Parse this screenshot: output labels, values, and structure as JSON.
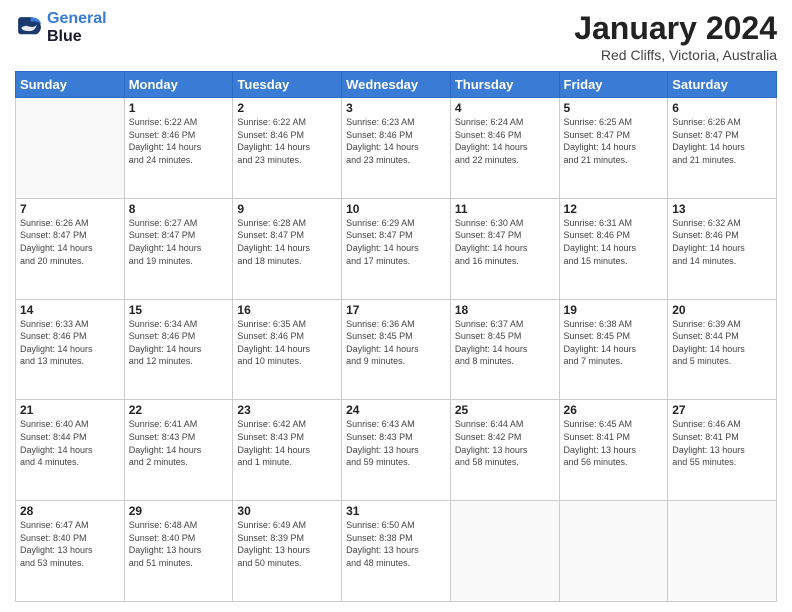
{
  "logo": {
    "line1": "General",
    "line2": "Blue"
  },
  "title": "January 2024",
  "location": "Red Cliffs, Victoria, Australia",
  "weekdays": [
    "Sunday",
    "Monday",
    "Tuesday",
    "Wednesday",
    "Thursday",
    "Friday",
    "Saturday"
  ],
  "weeks": [
    [
      {
        "day": "",
        "info": ""
      },
      {
        "day": "1",
        "info": "Sunrise: 6:22 AM\nSunset: 8:46 PM\nDaylight: 14 hours\nand 24 minutes."
      },
      {
        "day": "2",
        "info": "Sunrise: 6:22 AM\nSunset: 8:46 PM\nDaylight: 14 hours\nand 23 minutes."
      },
      {
        "day": "3",
        "info": "Sunrise: 6:23 AM\nSunset: 8:46 PM\nDaylight: 14 hours\nand 23 minutes."
      },
      {
        "day": "4",
        "info": "Sunrise: 6:24 AM\nSunset: 8:46 PM\nDaylight: 14 hours\nand 22 minutes."
      },
      {
        "day": "5",
        "info": "Sunrise: 6:25 AM\nSunset: 8:47 PM\nDaylight: 14 hours\nand 21 minutes."
      },
      {
        "day": "6",
        "info": "Sunrise: 6:26 AM\nSunset: 8:47 PM\nDaylight: 14 hours\nand 21 minutes."
      }
    ],
    [
      {
        "day": "7",
        "info": "Sunrise: 6:26 AM\nSunset: 8:47 PM\nDaylight: 14 hours\nand 20 minutes."
      },
      {
        "day": "8",
        "info": "Sunrise: 6:27 AM\nSunset: 8:47 PM\nDaylight: 14 hours\nand 19 minutes."
      },
      {
        "day": "9",
        "info": "Sunrise: 6:28 AM\nSunset: 8:47 PM\nDaylight: 14 hours\nand 18 minutes."
      },
      {
        "day": "10",
        "info": "Sunrise: 6:29 AM\nSunset: 8:47 PM\nDaylight: 14 hours\nand 17 minutes."
      },
      {
        "day": "11",
        "info": "Sunrise: 6:30 AM\nSunset: 8:47 PM\nDaylight: 14 hours\nand 16 minutes."
      },
      {
        "day": "12",
        "info": "Sunrise: 6:31 AM\nSunset: 8:46 PM\nDaylight: 14 hours\nand 15 minutes."
      },
      {
        "day": "13",
        "info": "Sunrise: 6:32 AM\nSunset: 8:46 PM\nDaylight: 14 hours\nand 14 minutes."
      }
    ],
    [
      {
        "day": "14",
        "info": "Sunrise: 6:33 AM\nSunset: 8:46 PM\nDaylight: 14 hours\nand 13 minutes."
      },
      {
        "day": "15",
        "info": "Sunrise: 6:34 AM\nSunset: 8:46 PM\nDaylight: 14 hours\nand 12 minutes."
      },
      {
        "day": "16",
        "info": "Sunrise: 6:35 AM\nSunset: 8:46 PM\nDaylight: 14 hours\nand 10 minutes."
      },
      {
        "day": "17",
        "info": "Sunrise: 6:36 AM\nSunset: 8:45 PM\nDaylight: 14 hours\nand 9 minutes."
      },
      {
        "day": "18",
        "info": "Sunrise: 6:37 AM\nSunset: 8:45 PM\nDaylight: 14 hours\nand 8 minutes."
      },
      {
        "day": "19",
        "info": "Sunrise: 6:38 AM\nSunset: 8:45 PM\nDaylight: 14 hours\nand 7 minutes."
      },
      {
        "day": "20",
        "info": "Sunrise: 6:39 AM\nSunset: 8:44 PM\nDaylight: 14 hours\nand 5 minutes."
      }
    ],
    [
      {
        "day": "21",
        "info": "Sunrise: 6:40 AM\nSunset: 8:44 PM\nDaylight: 14 hours\nand 4 minutes."
      },
      {
        "day": "22",
        "info": "Sunrise: 6:41 AM\nSunset: 8:43 PM\nDaylight: 14 hours\nand 2 minutes."
      },
      {
        "day": "23",
        "info": "Sunrise: 6:42 AM\nSunset: 8:43 PM\nDaylight: 14 hours\nand 1 minute."
      },
      {
        "day": "24",
        "info": "Sunrise: 6:43 AM\nSunset: 8:43 PM\nDaylight: 13 hours\nand 59 minutes."
      },
      {
        "day": "25",
        "info": "Sunrise: 6:44 AM\nSunset: 8:42 PM\nDaylight: 13 hours\nand 58 minutes."
      },
      {
        "day": "26",
        "info": "Sunrise: 6:45 AM\nSunset: 8:41 PM\nDaylight: 13 hours\nand 56 minutes."
      },
      {
        "day": "27",
        "info": "Sunrise: 6:46 AM\nSunset: 8:41 PM\nDaylight: 13 hours\nand 55 minutes."
      }
    ],
    [
      {
        "day": "28",
        "info": "Sunrise: 6:47 AM\nSunset: 8:40 PM\nDaylight: 13 hours\nand 53 minutes."
      },
      {
        "day": "29",
        "info": "Sunrise: 6:48 AM\nSunset: 8:40 PM\nDaylight: 13 hours\nand 51 minutes."
      },
      {
        "day": "30",
        "info": "Sunrise: 6:49 AM\nSunset: 8:39 PM\nDaylight: 13 hours\nand 50 minutes."
      },
      {
        "day": "31",
        "info": "Sunrise: 6:50 AM\nSunset: 8:38 PM\nDaylight: 13 hours\nand 48 minutes."
      },
      {
        "day": "",
        "info": ""
      },
      {
        "day": "",
        "info": ""
      },
      {
        "day": "",
        "info": ""
      }
    ]
  ]
}
